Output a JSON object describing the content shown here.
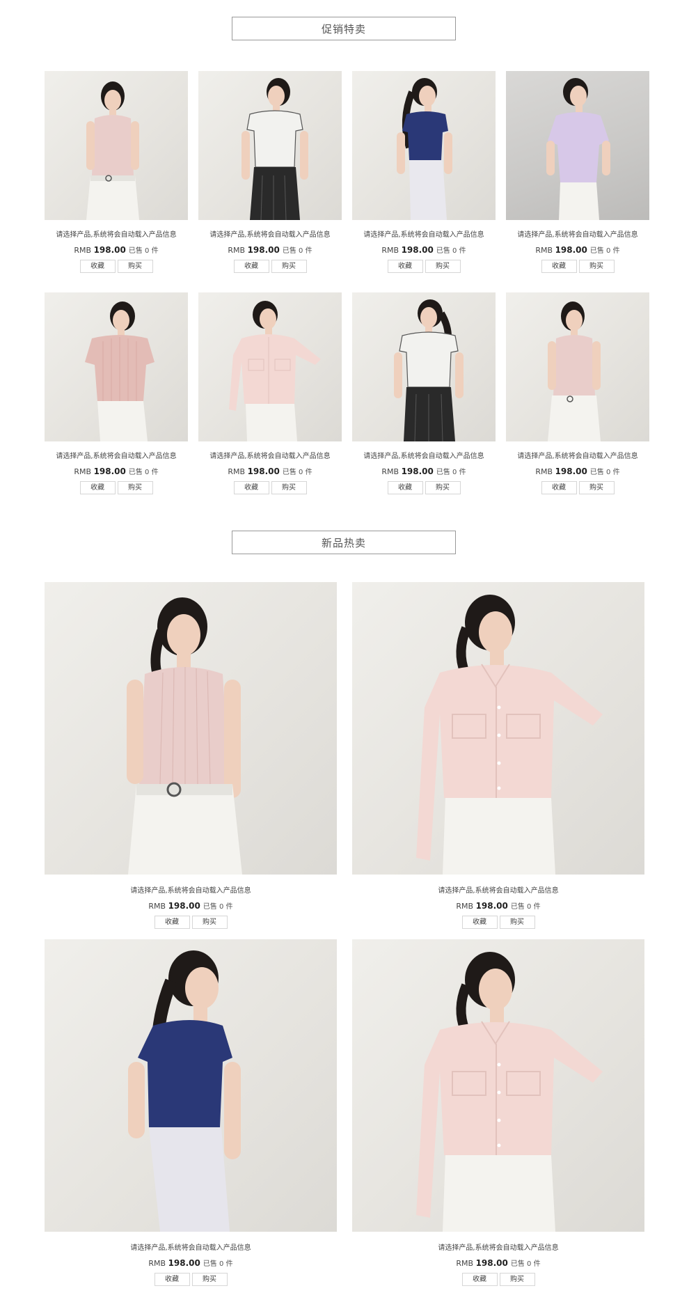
{
  "sections": {
    "promo_title": "促销特卖",
    "new_title": "新品热卖"
  },
  "product": {
    "desc": "请选择产品,系统将会自动载入产品信息",
    "currency": "RMB",
    "price": "198.00",
    "sold": "已售 0 件",
    "favorite_label": "收藏",
    "buy_label": "购买"
  },
  "colors": {
    "pink_knit": "#e9cdca",
    "white_tee": "#f2f2ef",
    "navy_tee": "#2a3877",
    "lilac_blouse": "#d7c8e8",
    "pink_shirt": "#f3d8d3",
    "white_pants": "#f4f3ef",
    "black_pants": "#2a2a2a",
    "skin": "#efd0bd",
    "hair": "#1f1a18"
  }
}
